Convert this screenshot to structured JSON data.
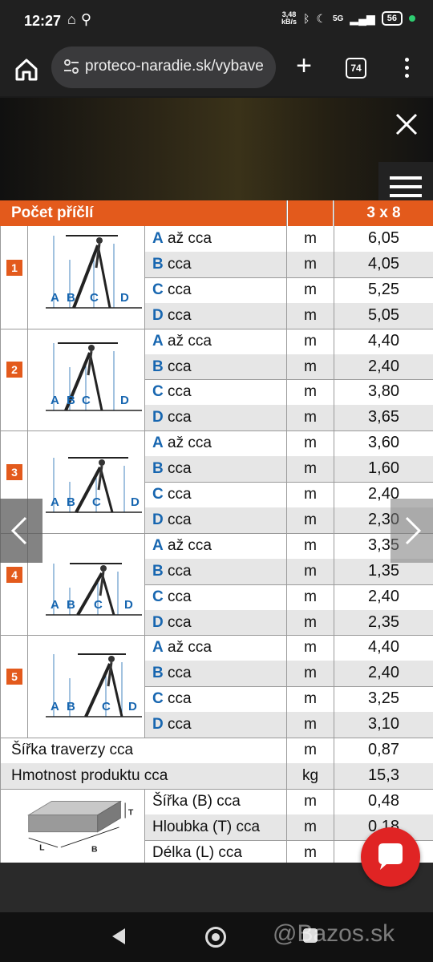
{
  "status": {
    "time": "12:27",
    "speed": "3,48\nkB/s",
    "network": "5G",
    "battery": "56"
  },
  "browser": {
    "url": "proteco-naradie.sk/vybave",
    "tab_count": "74"
  },
  "table": {
    "header": {
      "label": "Počet příčlí",
      "value": "3 x 8"
    },
    "groups": [
      {
        "num": "1",
        "rows": [
          {
            "letter": "A",
            "text": " až cca",
            "unit": "m",
            "value": "6,05"
          },
          {
            "letter": "B",
            "text": " cca",
            "unit": "m",
            "value": "4,05"
          },
          {
            "letter": "C",
            "text": " cca",
            "unit": "m",
            "value": "5,25"
          },
          {
            "letter": "D",
            "text": " cca",
            "unit": "m",
            "value": "5,05"
          }
        ]
      },
      {
        "num": "2",
        "rows": [
          {
            "letter": "A",
            "text": " až cca",
            "unit": "m",
            "value": "4,40"
          },
          {
            "letter": "B",
            "text": " cca",
            "unit": "m",
            "value": "2,40"
          },
          {
            "letter": "C",
            "text": " cca",
            "unit": "m",
            "value": "3,80"
          },
          {
            "letter": "D",
            "text": " cca",
            "unit": "m",
            "value": "3,65"
          }
        ]
      },
      {
        "num": "3",
        "rows": [
          {
            "letter": "A",
            "text": " až cca",
            "unit": "m",
            "value": "3,60"
          },
          {
            "letter": "B",
            "text": " cca",
            "unit": "m",
            "value": "1,60"
          },
          {
            "letter": "C",
            "text": " cca",
            "unit": "m",
            "value": "2,40"
          },
          {
            "letter": "D",
            "text": " cca",
            "unit": "m",
            "value": "2,30"
          }
        ]
      },
      {
        "num": "4",
        "rows": [
          {
            "letter": "A",
            "text": " až cca",
            "unit": "m",
            "value": "3,35"
          },
          {
            "letter": "B",
            "text": " cca",
            "unit": "m",
            "value": "1,35"
          },
          {
            "letter": "C",
            "text": " cca",
            "unit": "m",
            "value": "2,40"
          },
          {
            "letter": "D",
            "text": " cca",
            "unit": "m",
            "value": "2,35"
          }
        ]
      },
      {
        "num": "5",
        "rows": [
          {
            "letter": "A",
            "text": " až cca",
            "unit": "m",
            "value": "4,40"
          },
          {
            "letter": "B",
            "text": " cca",
            "unit": "m",
            "value": "2,40"
          },
          {
            "letter": "C",
            "text": " cca",
            "unit": "m",
            "value": "3,25"
          },
          {
            "letter": "D",
            "text": " cca",
            "unit": "m",
            "value": "3,10"
          }
        ]
      }
    ],
    "traverse": {
      "label": "Šířka traverzy cca",
      "unit": "m",
      "value": "0,87"
    },
    "weight": {
      "label": "Hmotnost produktu cca",
      "unit": "kg",
      "value": "15,3"
    },
    "package": {
      "diagram_labels": {
        "t": "T",
        "l": "L",
        "b": "B"
      },
      "rows": [
        {
          "label": "Šířka (B) cca",
          "unit": "m",
          "value": "0,48"
        },
        {
          "label": "Hloubka (T) cca",
          "unit": "m",
          "value": "0,18"
        },
        {
          "label": "Délka (L) cca",
          "unit": "m",
          "value": ""
        }
      ]
    },
    "diagram_labels": {
      "a": "A",
      "b": "B",
      "c": "C",
      "d": "D"
    }
  },
  "watermark": "@Bazos.sk",
  "colors": {
    "accent": "#e35a1c",
    "letter": "#1766b0",
    "chat": "#e02424"
  }
}
